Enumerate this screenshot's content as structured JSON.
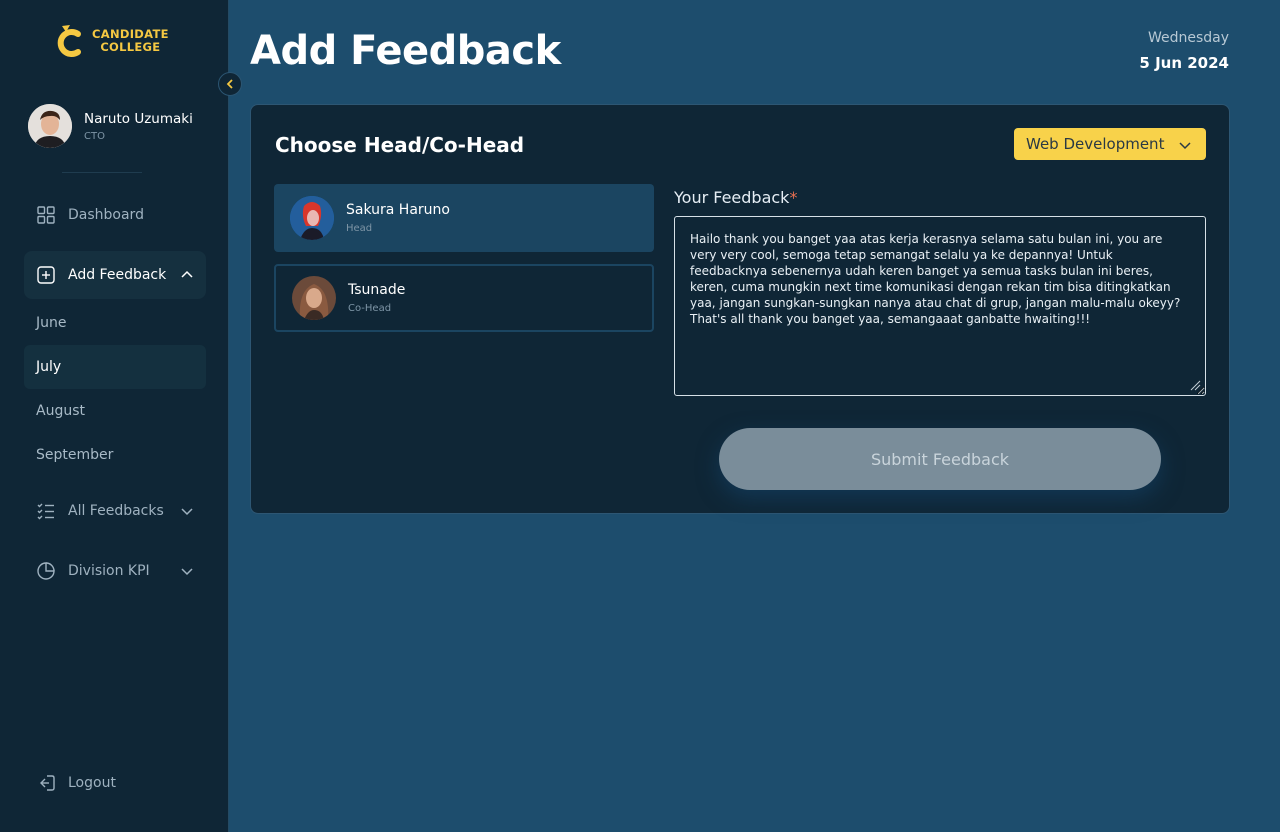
{
  "brand": {
    "line1": "CANDIDATE",
    "line2": "COLLEGE",
    "color": "#f5c842"
  },
  "profile": {
    "name": "Naruto Uzumaki",
    "role": "CTO"
  },
  "nav": {
    "dashboard": "Dashboard",
    "add_feedback": "Add Feedback",
    "months": [
      "June",
      "July",
      "August",
      "September"
    ],
    "all_feedbacks": "All Feedbacks",
    "division_kpi": "Division KPI",
    "logout": "Logout"
  },
  "header": {
    "title": "Add Feedback",
    "day": "Wednesday",
    "date": "5 Jun 2024"
  },
  "card": {
    "title": "Choose Head/Co-Head",
    "division": "Web Development",
    "people": [
      {
        "name": "Sakura Haruno",
        "role": "Head"
      },
      {
        "name": "Tsunade",
        "role": "Co-Head"
      }
    ],
    "feedback_label": "Your Feedback",
    "required_mark": "*",
    "feedback_text": "Hailo thank you banget yaa atas kerja kerasnya selama satu bulan ini, you are very very cool, semoga tetap semangat selalu ya ke depannya! Untuk feedbacknya sebenernya udah keren banget ya semua tasks bulan ini beres, keren, cuma mungkin next time komunikasi dengan rekan tim bisa ditingkatkan yaa, jangan sungkan-sungkan nanya atau chat di grup, jangan malu-malu okeyy? That's all thank you banget yaa, semangaaat ganbatte hwaiting!!!",
    "submit": "Submit Feedback"
  },
  "colors": {
    "accent": "#f8d24a",
    "sidebar": "#0f2636",
    "background": "#1d4d6d",
    "selected": "#1b4561"
  }
}
